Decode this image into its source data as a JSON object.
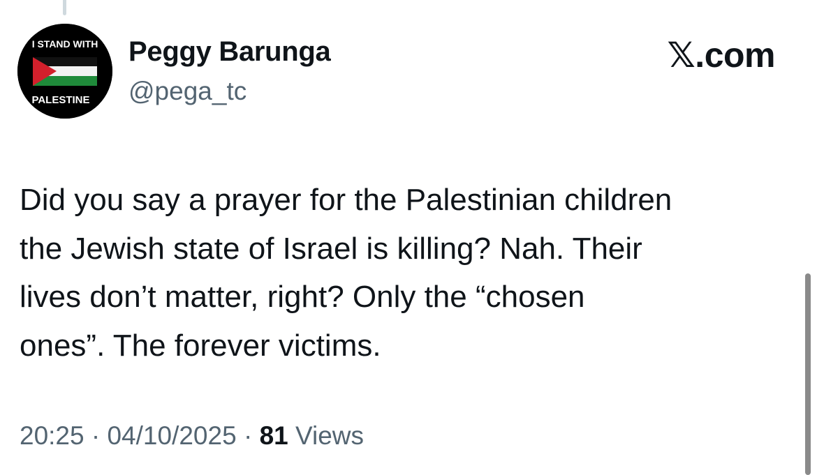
{
  "author": {
    "display_name": "Peggy Barunga",
    "handle": "@pega_tc",
    "avatar": {
      "top_text": "I STAND WITH",
      "bottom_text": "PALESTINE",
      "flag_colors": {
        "black": "#111111",
        "white": "#f2f2f2",
        "green": "#1f8a3a",
        "red": "#d3202c"
      }
    }
  },
  "watermark": "𝕏.com",
  "tweet": {
    "text": "Did you say a prayer for the Palestinian children\nthe Jewish state of Israel is killing? Nah. Their\nlives don’t matter, right? Only the “chosen\nones”. The forever victims."
  },
  "meta": {
    "time": "20:25",
    "separator": "·",
    "date": "04/10/2025",
    "views_count": "81",
    "views_label": "Views"
  },
  "colors": {
    "text_primary": "#0f1419",
    "text_secondary": "#536471",
    "thread_line": "#cfd9de"
  }
}
